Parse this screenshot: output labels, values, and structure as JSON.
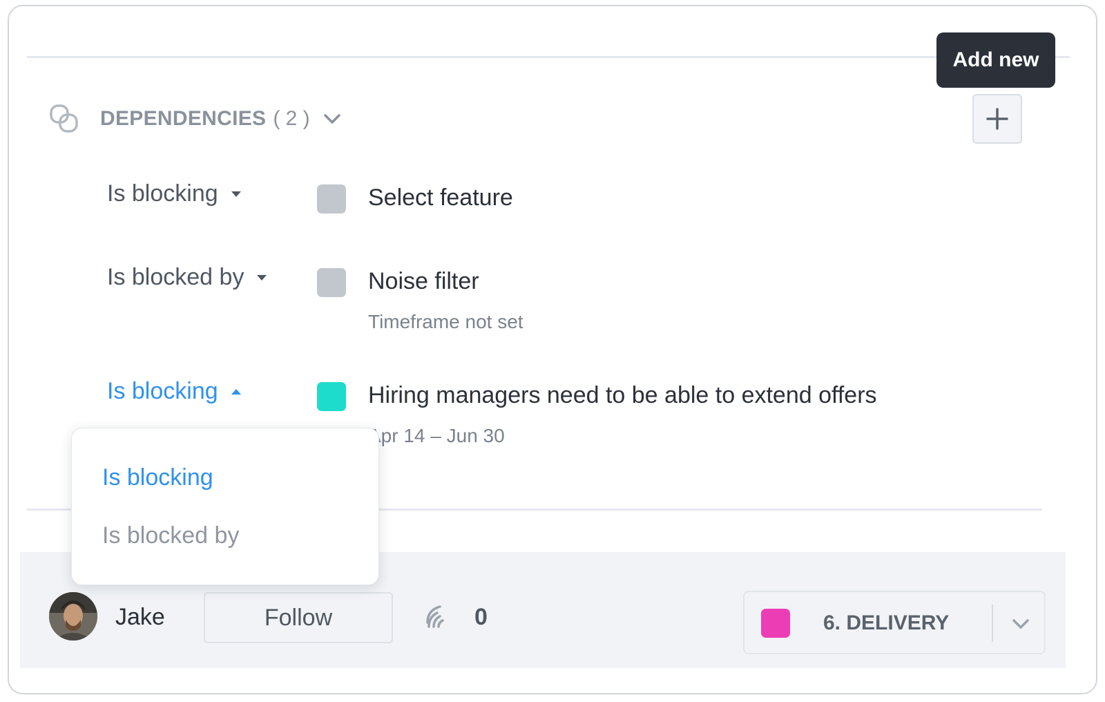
{
  "tooltip": {
    "text": "Add new"
  },
  "dependencies": {
    "title": "DEPENDENCIES",
    "count": "( 2 )",
    "items": [
      {
        "relation": "Is blocking",
        "title": "Select feature",
        "subtitle": "",
        "status_color": "#c2c7cd",
        "relation_open": false
      },
      {
        "relation": "Is blocked by",
        "title": "Noise filter",
        "subtitle": "Timeframe not set",
        "status_color": "#c2c7cd",
        "relation_open": false
      },
      {
        "relation": "Is blocking",
        "title": "Hiring managers need to be able to extend offers",
        "subtitle": "Apr 14 – Jun 30",
        "status_color": "#1edccb",
        "relation_open": true
      }
    ]
  },
  "relation_dropdown": {
    "options": [
      "Is blocking",
      "Is blocked by"
    ],
    "selected": "Is blocking"
  },
  "footer": {
    "user_name": "Jake",
    "follow_label": "Follow",
    "signal_count": "0",
    "stage": {
      "label": "6. DELIVERY",
      "color": "#ec3db5"
    }
  },
  "colors": {
    "accent": "#2f91ef",
    "tooltip_bg": "#2b3039"
  }
}
